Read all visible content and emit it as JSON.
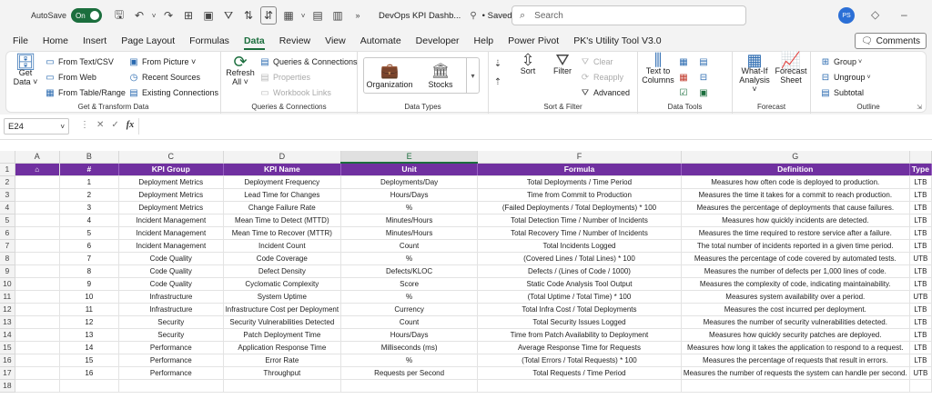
{
  "titlebar": {
    "autosave_label": "AutoSave",
    "autosave_state": "On",
    "doc_title": "DevOps KPI Dashb...",
    "saved_label": "• Saved",
    "search_placeholder": "Search",
    "avatar_initials": "PS"
  },
  "menu": [
    "File",
    "Home",
    "Insert",
    "Page Layout",
    "Formulas",
    "Data",
    "Review",
    "View",
    "Automate",
    "Developer",
    "Help",
    "Power Pivot",
    "PK's Utility Tool V3.0"
  ],
  "active_menu": "Data",
  "comments_label": "Comments",
  "ribbon": {
    "get_transform": {
      "get_data_1": "Get",
      "get_data_2": "Data ˅",
      "from_text": "From Text/CSV",
      "from_web": "From Web",
      "from_table": "From Table/Range",
      "from_picture": "From Picture ˅",
      "recent": "Recent Sources",
      "existing": "Existing Connections",
      "label": "Get & Transform Data"
    },
    "queries": {
      "refresh_1": "Refresh",
      "refresh_2": "All ˅",
      "qc": "Queries & Connections",
      "props": "Properties",
      "links": "Workbook Links",
      "label": "Queries & Connections"
    },
    "datatypes": {
      "org": "Organization",
      "stocks": "Stocks",
      "label": "Data Types"
    },
    "sortfilter": {
      "sort": "Sort",
      "filter": "Filter",
      "clear": "Clear",
      "reapply": "Reapply",
      "advanced": "Advanced",
      "label": "Sort & Filter"
    },
    "datatools": {
      "ttc_1": "Text to",
      "ttc_2": "Columns",
      "label": "Data Tools"
    },
    "forecast": {
      "whatif_1": "What-If",
      "whatif_2": "Analysis ˅",
      "sheet_1": "Forecast",
      "sheet_2": "Sheet",
      "label": "Forecast"
    },
    "outline": {
      "group": "Group",
      "ungroup": "Ungroup",
      "subtotal": "Subtotal",
      "label": "Outline"
    }
  },
  "formula_bar": {
    "name_box": "E24",
    "formula": ""
  },
  "columns": [
    "A",
    "B",
    "C",
    "D",
    "E",
    "F",
    "G"
  ],
  "selected_column": "E",
  "table": {
    "headers": [
      "#",
      "KPI Group",
      "KPI Name",
      "Unit",
      "Formula",
      "Definition",
      "Type"
    ],
    "rows": [
      [
        "1",
        "Deployment Metrics",
        "Deployment Frequency",
        "Deployments/Day",
        "Total Deployments / Time Period",
        "Measures how often code is deployed to production.",
        "LTB"
      ],
      [
        "2",
        "Deployment Metrics",
        "Lead Time for Changes",
        "Hours/Days",
        "Time from Commit to Production",
        "Measures the time it takes for a commit to reach production.",
        "LTB"
      ],
      [
        "3",
        "Deployment Metrics",
        "Change Failure Rate",
        "%",
        "(Failed Deployments / Total Deployments) * 100",
        "Measures the percentage of deployments that cause failures.",
        "LTB"
      ],
      [
        "4",
        "Incident Management",
        "Mean Time to Detect (MTTD)",
        "Minutes/Hours",
        "Total Detection Time / Number of Incidents",
        "Measures how quickly incidents are detected.",
        "LTB"
      ],
      [
        "5",
        "Incident Management",
        "Mean Time to Recover (MTTR)",
        "Minutes/Hours",
        "Total Recovery Time / Number of Incidents",
        "Measures the time required to restore service after a failure.",
        "LTB"
      ],
      [
        "6",
        "Incident Management",
        "Incident Count",
        "Count",
        "Total Incidents Logged",
        "The total number of incidents reported in a given time period.",
        "LTB"
      ],
      [
        "7",
        "Code Quality",
        "Code Coverage",
        "%",
        "(Covered Lines / Total Lines) * 100",
        "Measures the percentage of code covered by automated tests.",
        "UTB"
      ],
      [
        "8",
        "Code Quality",
        "Defect Density",
        "Defects/KLOC",
        "Defects / (Lines of Code / 1000)",
        "Measures the number of defects per 1,000 lines of code.",
        "LTB"
      ],
      [
        "9",
        "Code Quality",
        "Cyclomatic Complexity",
        "Score",
        "Static Code Analysis Tool Output",
        "Measures the complexity of code, indicating maintainability.",
        "LTB"
      ],
      [
        "10",
        "Infrastructure",
        "System Uptime",
        "%",
        "(Total Uptime / Total Time) * 100",
        "Measures system availability over a period.",
        "UTB"
      ],
      [
        "11",
        "Infrastructure",
        "Infrastructure Cost per Deployment",
        "Currency",
        "Total Infra Cost / Total Deployments",
        "Measures the cost incurred per deployment.",
        "LTB"
      ],
      [
        "12",
        "Security",
        "Security Vulnerabilities Detected",
        "Count",
        "Total Security Issues Logged",
        "Measures the number of security vulnerabilities detected.",
        "LTB"
      ],
      [
        "13",
        "Security",
        "Patch Deployment Time",
        "Hours/Days",
        "Time from Patch Availability to Deployment",
        "Measures how quickly security patches are deployed.",
        "LTB"
      ],
      [
        "14",
        "Performance",
        "Application Response Time",
        "Milliseconds (ms)",
        "Average Response Time for Requests",
        "Measures how long it takes the application to respond to a request.",
        "LTB"
      ],
      [
        "15",
        "Performance",
        "Error Rate",
        "%",
        "(Total Errors / Total Requests) * 100",
        "Measures the percentage of requests that result in errors.",
        "LTB"
      ],
      [
        "16",
        "Performance",
        "Throughput",
        "Requests per Second",
        "Total Requests / Time Period",
        "Measures the number of requests the system can handle per second.",
        "UTB"
      ]
    ]
  },
  "colors": {
    "header_purple": "#7030a0",
    "excel_green": "#1b6e3d"
  }
}
